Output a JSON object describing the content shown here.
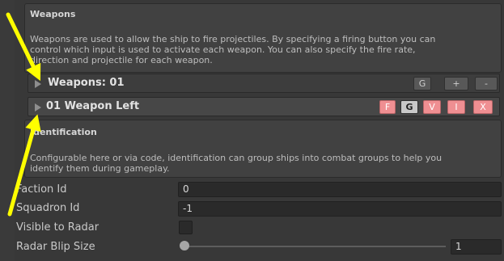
{
  "weapons_section": {
    "heading": "Weapons",
    "description": "Weapons are used to allow the ship to fire projectiles. By specifying a firing button you can\ncontrol which input is used to activate each weapon. You can also specify the fire rate,\ndirection and projectile for each weapon.",
    "list_header": {
      "label": "Weapons: 01",
      "buttons": [
        "G",
        "+",
        "-"
      ]
    },
    "item": {
      "label": "01 Weapon Left",
      "buttons": [
        "F",
        "G",
        "V",
        "I",
        "X"
      ]
    }
  },
  "identification_section": {
    "heading": "Identification",
    "description": "Configurable here or via code, identification can group ships into combat groups to help you\nidentify them during gameplay.",
    "fields": {
      "faction_id": {
        "label": "Faction Id",
        "value": "0"
      },
      "squadron_id": {
        "label": "Squadron Id",
        "value": "-1"
      },
      "visible_to_radar": {
        "label": "Visible to Radar",
        "checked": false
      },
      "radar_blip_size": {
        "label": "Radar Blip Size",
        "value": "1",
        "slider_fraction": 0.0
      }
    }
  },
  "annotation": {
    "arrow_color": "#ffff00",
    "count": 2
  },
  "colors": {
    "accent_button": "#ef8f92",
    "active_button": "#c8c8c8",
    "background": "#383838"
  }
}
